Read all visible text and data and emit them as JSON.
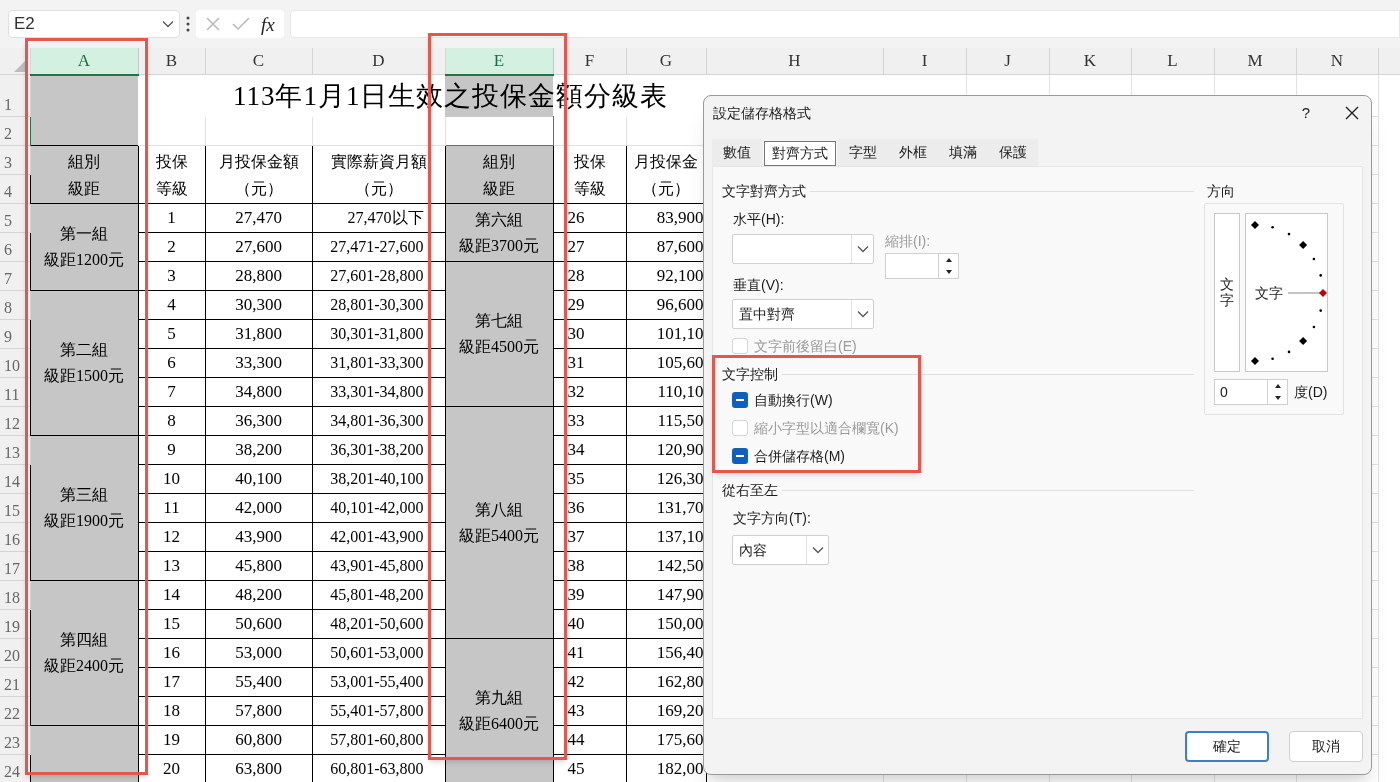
{
  "name_box": {
    "value": "E2"
  },
  "formula_bar": {
    "fx_label": "fx"
  },
  "column_headers": [
    {
      "label": "A",
      "selected": true
    },
    {
      "label": "B",
      "selected": false
    },
    {
      "label": "C",
      "selected": false
    },
    {
      "label": "D",
      "selected": false
    },
    {
      "label": "E",
      "selected": true
    },
    {
      "label": "F",
      "selected": false
    },
    {
      "label": "G",
      "selected": false
    },
    {
      "label": "H",
      "selected": false
    },
    {
      "label": "I",
      "selected": false
    },
    {
      "label": "J",
      "selected": false
    },
    {
      "label": "K",
      "selected": false
    },
    {
      "label": "L",
      "selected": false
    },
    {
      "label": "M",
      "selected": false
    },
    {
      "label": "N",
      "selected": false
    }
  ],
  "row_headers": [
    "1",
    "2",
    "3",
    "4",
    "5",
    "6",
    "7",
    "8",
    "9",
    "10",
    "11",
    "12",
    "13",
    "14",
    "15",
    "16",
    "17",
    "18",
    "19",
    "20",
    "21",
    "22",
    "23",
    "24"
  ],
  "sheet": {
    "title": "113年1月1日生效之投保金額分級表",
    "header_left": [
      [
        "組別",
        "級距"
      ],
      [
        "投保",
        "等級"
      ],
      [
        "月投保金額",
        "（元）"
      ],
      [
        "實際薪資月額",
        "（元）"
      ]
    ],
    "header_right": [
      [
        "組別",
        "級距"
      ],
      [
        "投保",
        "等級"
      ],
      [
        "月投保金",
        "（元）"
      ]
    ],
    "left_groups": [
      {
        "label": [
          "第一組",
          "級距1200元"
        ],
        "rows": [
          [
            "1",
            "27,470",
            "27,470以下"
          ],
          [
            "2",
            "27,600",
            "27,471-27,600"
          ],
          [
            "3",
            "28,800",
            "27,601-28,800"
          ]
        ]
      },
      {
        "label": [
          "第二組",
          "級距1500元"
        ],
        "rows": [
          [
            "4",
            "30,300",
            "28,801-30,300"
          ],
          [
            "5",
            "31,800",
            "30,301-31,800"
          ],
          [
            "6",
            "33,300",
            "31,801-33,300"
          ],
          [
            "7",
            "34,800",
            "33,301-34,800"
          ],
          [
            "8",
            "36,300",
            "34,801-36,300"
          ]
        ]
      },
      {
        "label": [
          "第三組",
          "級距1900元"
        ],
        "rows": [
          [
            "9",
            "38,200",
            "36,301-38,200"
          ],
          [
            "10",
            "40,100",
            "38,201-40,100"
          ],
          [
            "11",
            "42,000",
            "40,101-42,000"
          ],
          [
            "12",
            "43,900",
            "42,001-43,900"
          ],
          [
            "13",
            "45,800",
            "43,901-45,800"
          ]
        ]
      },
      {
        "label": [
          "第四組",
          "級距2400元"
        ],
        "rows": [
          [
            "14",
            "48,200",
            "45,801-48,200"
          ],
          [
            "15",
            "50,600",
            "48,201-50,600"
          ],
          [
            "16",
            "53,000",
            "50,601-53,000"
          ],
          [
            "17",
            "55,400",
            "53,001-55,400"
          ],
          [
            "18",
            "57,800",
            "55,401-57,800"
          ]
        ]
      },
      {
        "rows": [
          [
            "19",
            "60,800",
            "57,801-60,800"
          ],
          [
            "20",
            "63,800",
            "60,801-63,800"
          ]
        ]
      }
    ],
    "right_groups": [
      {
        "label": [
          "第六組",
          "級距3700元"
        ],
        "rows": [
          [
            "26",
            "83,900"
          ],
          [
            "27",
            "87,600"
          ]
        ]
      },
      {
        "label": [
          "第七組",
          "級距4500元"
        ],
        "rows": [
          [
            "28",
            "92,100"
          ],
          [
            "29",
            "96,600"
          ],
          [
            "30",
            "101,10"
          ],
          [
            "31",
            "105,60"
          ],
          [
            "32",
            "110,10"
          ]
        ]
      },
      {
        "label": [
          "第八組",
          "級距5400元"
        ],
        "rows": [
          [
            "33",
            "115,50"
          ],
          [
            "34",
            "120,90"
          ],
          [
            "35",
            "126,30"
          ],
          [
            "36",
            "131,70"
          ],
          [
            "37",
            "137,10"
          ],
          [
            "38",
            "142,50"
          ],
          [
            "39",
            "147,90"
          ],
          [
            "40",
            "150,00"
          ]
        ]
      },
      {
        "label": [
          "第九組",
          "級距6400元"
        ],
        "rows": [
          [
            "41",
            "156,40"
          ],
          [
            "42",
            "162,80"
          ],
          [
            "43",
            "169,20"
          ],
          [
            "44",
            "175,60"
          ],
          [
            "45",
            "182,00"
          ]
        ]
      }
    ]
  },
  "dialog": {
    "title": "設定儲存格格式",
    "help": "?",
    "tabs": [
      {
        "label": "數值",
        "selected": false
      },
      {
        "label": "對齊方式",
        "selected": true
      },
      {
        "label": "字型",
        "selected": false
      },
      {
        "label": "外框",
        "selected": false
      },
      {
        "label": "填滿",
        "selected": false
      },
      {
        "label": "保護",
        "selected": false
      }
    ],
    "alignment": {
      "heading": "文字對齊方式",
      "horizontal": {
        "label": "水平(H):"
      },
      "indent": {
        "label": "縮排(I):",
        "disabled": true
      },
      "vertical": {
        "label": "垂直(V):",
        "value": "置中對齊"
      },
      "justify_distributed": {
        "label": "文字前後留白(E)",
        "checked": false,
        "indeterminate": false,
        "disabled": true
      }
    },
    "text_control": {
      "heading": "文字控制",
      "options": [
        {
          "label": "自動換行(W)",
          "indeterminate": true,
          "disabled": false
        },
        {
          "label": "縮小字型以適合欄寬(K)",
          "checked": false,
          "indeterminate": false,
          "disabled": true
        },
        {
          "label": "合併儲存格(M)",
          "indeterminate": true,
          "disabled": false
        }
      ]
    },
    "right_to_left": {
      "heading": "從右至左",
      "direction": {
        "label": "文字方向(T):",
        "value": "內容"
      }
    },
    "orientation": {
      "heading": "方向",
      "vertical_text": "文字",
      "dial_text": "文字",
      "degrees": {
        "value": "0",
        "label": "度(D)"
      }
    },
    "buttons": [
      {
        "label": "確定",
        "default": true
      },
      {
        "label": "取消",
        "default": false
      }
    ]
  }
}
